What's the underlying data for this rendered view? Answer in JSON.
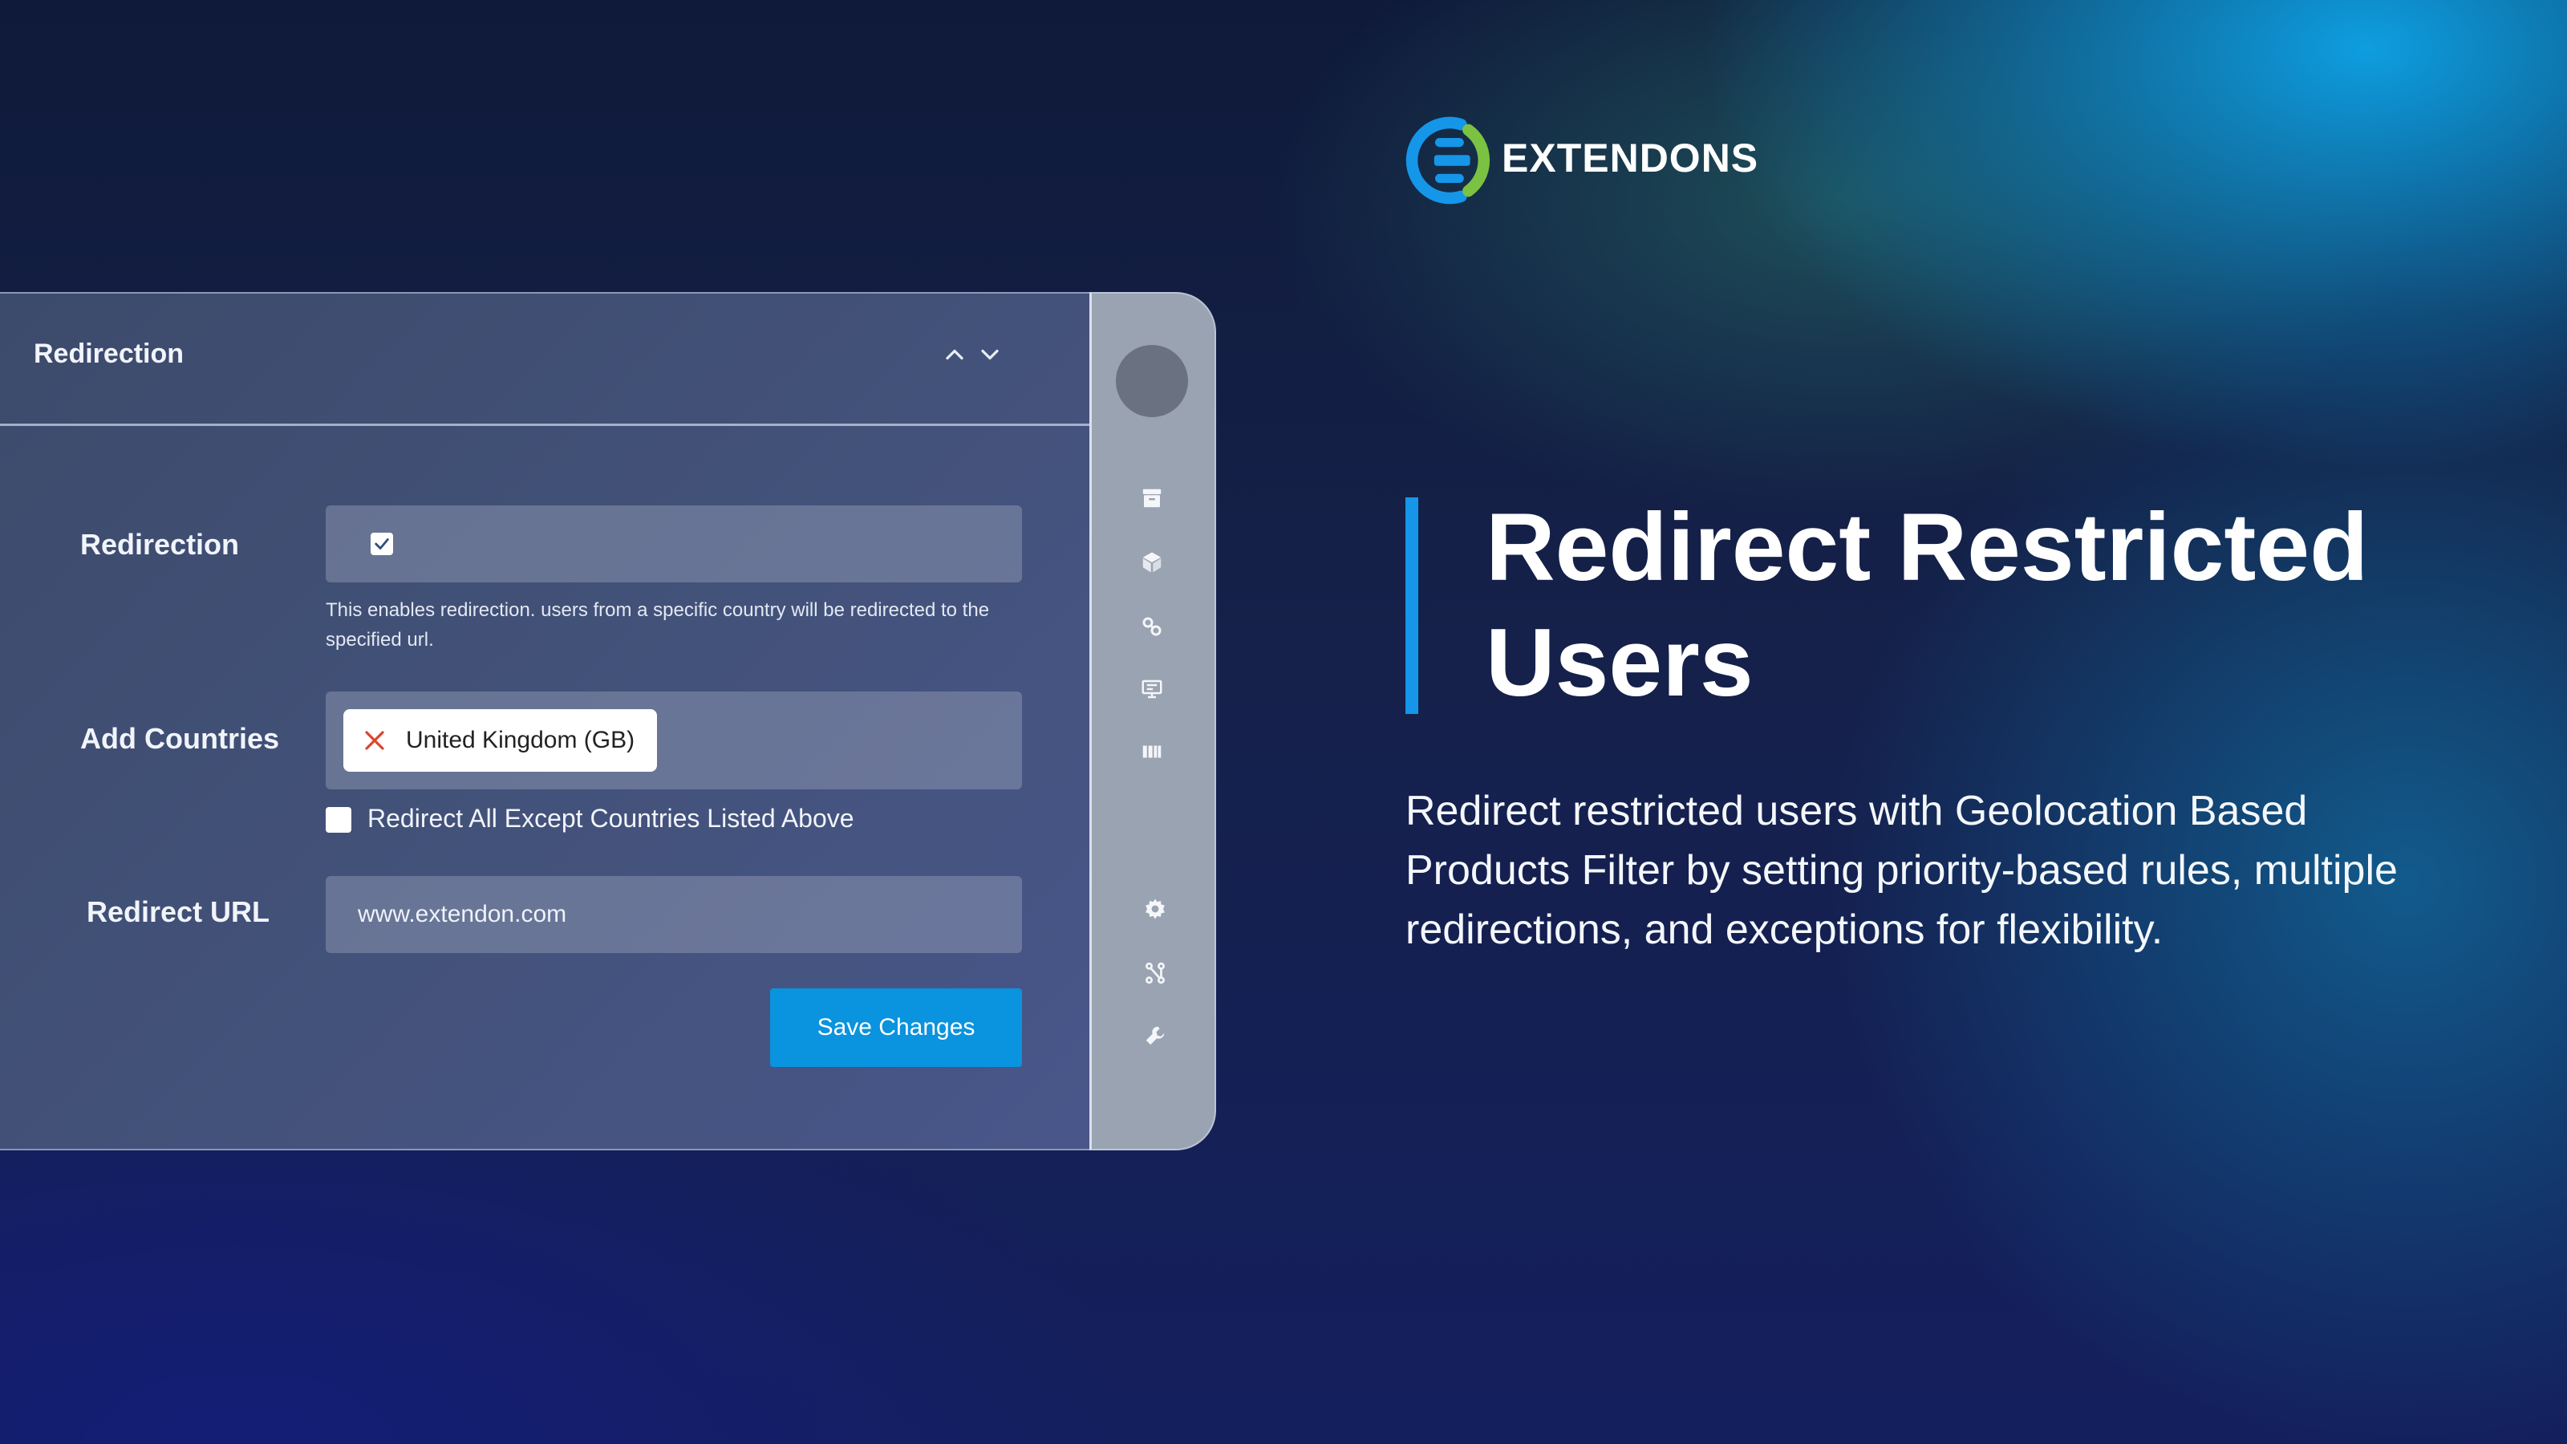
{
  "brand": {
    "name": "EXTENDONS",
    "logo_icon": "extendons-logo-icon",
    "colors": {
      "blue": "#1596e8",
      "green": "#7cc242"
    }
  },
  "panel": {
    "title": "Redirection",
    "collapse_icon": "chevron-up-icon",
    "expand_icon": "chevron-down-icon",
    "redirection": {
      "label": "Redirection",
      "checked": true,
      "help_text": "This enables redirection. users from a specific country will be redirected to the specified url."
    },
    "countries": {
      "label": "Add Countries",
      "selected": [
        "United Kingdom (GB)"
      ],
      "remove_icon": "close-icon"
    },
    "except": {
      "label": "Redirect All Except Countries Listed Above",
      "checked": false
    },
    "redirect_url": {
      "label": "Redirect URL",
      "value": "www.extendon.com"
    },
    "save_label": "Save Changes",
    "colors": {
      "save_button": "#0a93de",
      "remove_x": "#e0442b"
    }
  },
  "rail": {
    "icons": [
      "archive-icon",
      "cube-icon",
      "link-icon",
      "monitor-icon",
      "barcode-icon",
      "gear-icon",
      "nodes-icon",
      "wrench-icon"
    ]
  },
  "hero": {
    "title": "Redirect Restricted Users",
    "description": "Redirect restricted users with Geolocation Based Products Filter by setting priority-based rules, multiple redirections, and exceptions for flexibility."
  }
}
